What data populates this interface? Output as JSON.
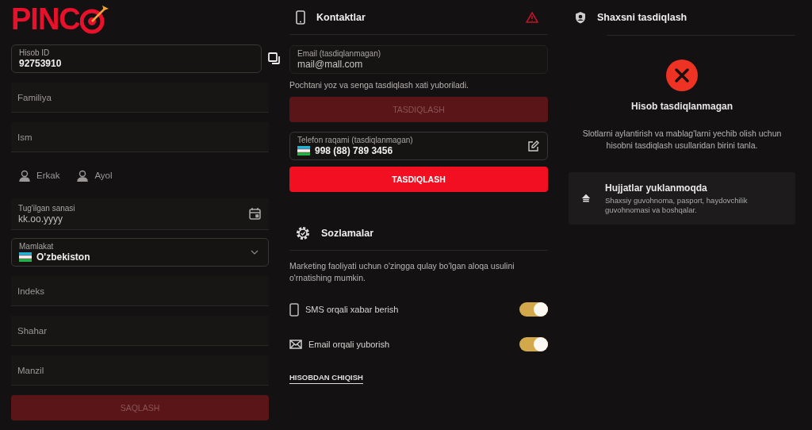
{
  "logo": {
    "text": "PINC"
  },
  "account_id": {
    "label": "Hisob ID",
    "value": "92753910"
  },
  "name_fields": [
    {
      "placeholder": "Familiya"
    },
    {
      "placeholder": "Ism"
    }
  ],
  "gender": [
    {
      "label": "Erkak",
      "selected": false
    },
    {
      "label": "Ayol",
      "selected": false
    }
  ],
  "birth_date": {
    "label": "Tug'ilgan sanasi",
    "placeholder": "kk.oo.yyyy"
  },
  "country": {
    "label": "Mamlakat",
    "value": "O'zbekiston"
  },
  "address_fields": [
    {
      "placeholder": "Indeks"
    },
    {
      "placeholder": "Shahar"
    },
    {
      "placeholder": "Manzil"
    }
  ],
  "save_button": {
    "label": "SAQLASH",
    "disabled": true
  },
  "contacts": {
    "title": "Kontaktlar",
    "warning": true,
    "email": {
      "label": "Email (tasdiqlanmagan)",
      "value": "mail@mall.com"
    },
    "email_hint": "Pochtani yoz va senga tasdiqlash xati yuboriladi.",
    "email_button": {
      "label": "TASDIQLASH",
      "disabled": true
    },
    "phone": {
      "label": "Telefon raqami (tasdiqlanmagan)",
      "value": "998 (88) 789 3456"
    },
    "phone_button": {
      "label": "TASDIQLASH",
      "disabled": false
    }
  },
  "settings": {
    "title": "Sozlamalar",
    "description": "Marketing faoliyati uchun o'zingga qulay bo'lgan aloqa usulini o'rnatishing mumkin.",
    "toggles": [
      {
        "kind": "sms",
        "label": "SMS orqali xabar berish",
        "on": true
      },
      {
        "kind": "email",
        "label": "Email orqali yuborish",
        "on": true
      }
    ],
    "logout": "HISOBDAN CHIQISH"
  },
  "verification": {
    "title": "Shaxsni tasdiqlash",
    "status": "Hisob tasdiqlanmagan",
    "description": "Slotlarni aylantirish va mablag'larni yechib olish uchun hisobni tasdiqlash usullaridan birini tanla.",
    "option": {
      "title": "Hujjatlar yuklanmoqda",
      "description": "Shaxsiy guvohnoma, pasport, haydovchilik guvohnomasi va boshqalar."
    }
  }
}
